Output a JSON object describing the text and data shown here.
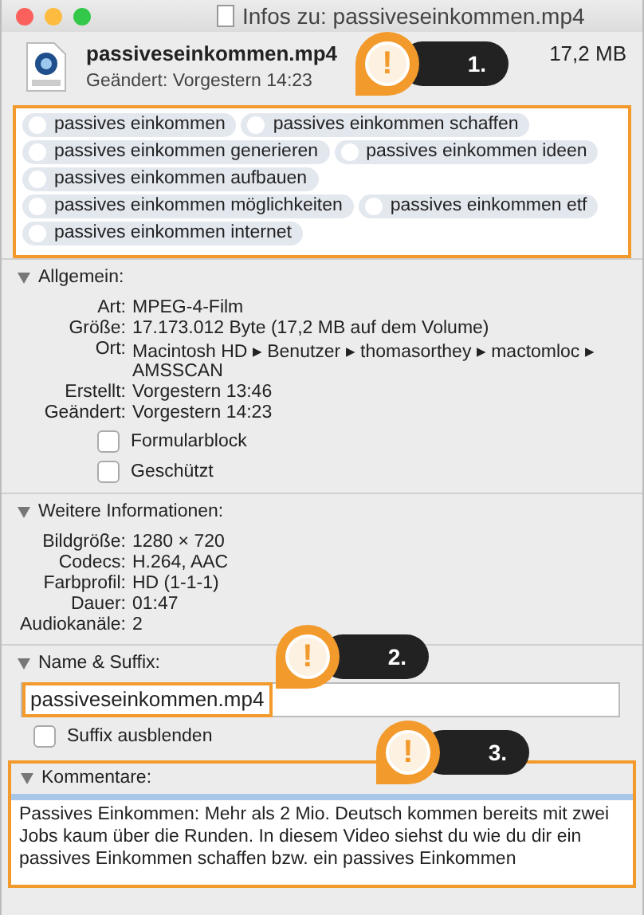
{
  "window": {
    "title": "Infos zu: passiveseinkommen.mp4"
  },
  "header": {
    "name": "passiveseinkommen.mp4",
    "modified": "Geändert: Vorgestern 14:23",
    "size": "17,2 MB"
  },
  "tags": [
    "passives einkommen",
    "passives einkommen schaffen",
    "passives einkommen generieren",
    "passives einkommen ideen",
    "passives einkommen aufbauen",
    "passives einkommen möglichkeiten",
    "passives einkommen etf",
    "passives einkommen internet"
  ],
  "sections": [
    {
      "kind": "details",
      "title": "Allgemein:",
      "expanded": true,
      "rows": [
        {
          "label": "Art:",
          "value": "MPEG-4-Film"
        },
        {
          "label": "Größe:",
          "value": "17.173.012 Byte (17,2 MB auf dem Volume)"
        },
        {
          "label": "Ort:",
          "value": "Macintosh HD ▸ Benutzer ▸ thomasorthey ▸ mactomloc ▸ AMSSCAN"
        },
        {
          "label": "Erstellt:",
          "value": "Vorgestern 13:46"
        },
        {
          "label": "Geändert:",
          "value": "Vorgestern 14:23"
        }
      ],
      "checkboxes": [
        {
          "label": "Formularblock",
          "checked": false
        },
        {
          "label": "Geschützt",
          "checked": false
        }
      ]
    },
    {
      "kind": "details",
      "title": "Weitere Informationen:",
      "expanded": true,
      "rows": [
        {
          "label": "Bildgröße:",
          "value": "1280 × 720"
        },
        {
          "label": "Codecs:",
          "value": "H.264, AAC"
        },
        {
          "label": "Farbprofil:",
          "value": "HD (1-1-1)"
        },
        {
          "label": "Dauer:",
          "value": "01:47"
        },
        {
          "label": "Audiokanäle:",
          "value": "2"
        }
      ]
    },
    {
      "kind": "name",
      "title": "Name & Suffix:",
      "expanded": true,
      "value": "passiveseinkommen.mp4",
      "checkboxes": [
        {
          "label": "Suffix ausblenden",
          "checked": false
        }
      ]
    },
    {
      "kind": "comments",
      "title": "Kommentare:",
      "expanded": true,
      "text": "Passives Einkommen: Mehr als 2 Mio. Deutsch kommen bereits mit zwei Jobs kaum über die Runden. In diesem Video siehst du wie du dir ein passives Einkommen schaffen bzw. ein passives Einkommen"
    }
  ],
  "annotations": [
    {
      "mark": "!",
      "label": "1."
    },
    {
      "mark": "!",
      "label": "2."
    },
    {
      "mark": "!",
      "label": "3."
    }
  ]
}
